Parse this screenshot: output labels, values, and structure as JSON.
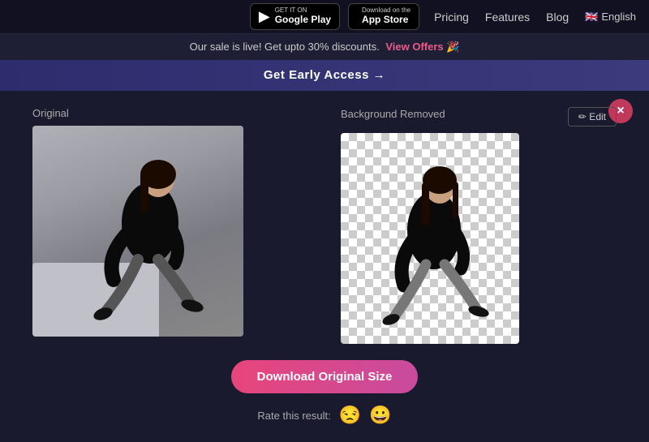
{
  "header": {
    "google_play_small": "GET IT ON",
    "google_play_big": "Google Play",
    "app_store_small": "Download on the",
    "app_store_big": "App Store",
    "nav": {
      "pricing": "Pricing",
      "features": "Features",
      "blog": "Blog",
      "language": "English"
    }
  },
  "promo": {
    "text": "Our sale is live! Get upto 30% discounts.",
    "link_text": "View Offers 🎉"
  },
  "early_access": {
    "label": "Get Early Access →"
  },
  "main": {
    "original_label": "Original",
    "bg_removed_label": "Background Removed",
    "edit_btn": "✏ Edit",
    "close_label": "×",
    "download_btn": "Download Original Size",
    "rate_label": "Rate this result:",
    "emoji_sad": "😒",
    "emoji_happy": "😀"
  }
}
